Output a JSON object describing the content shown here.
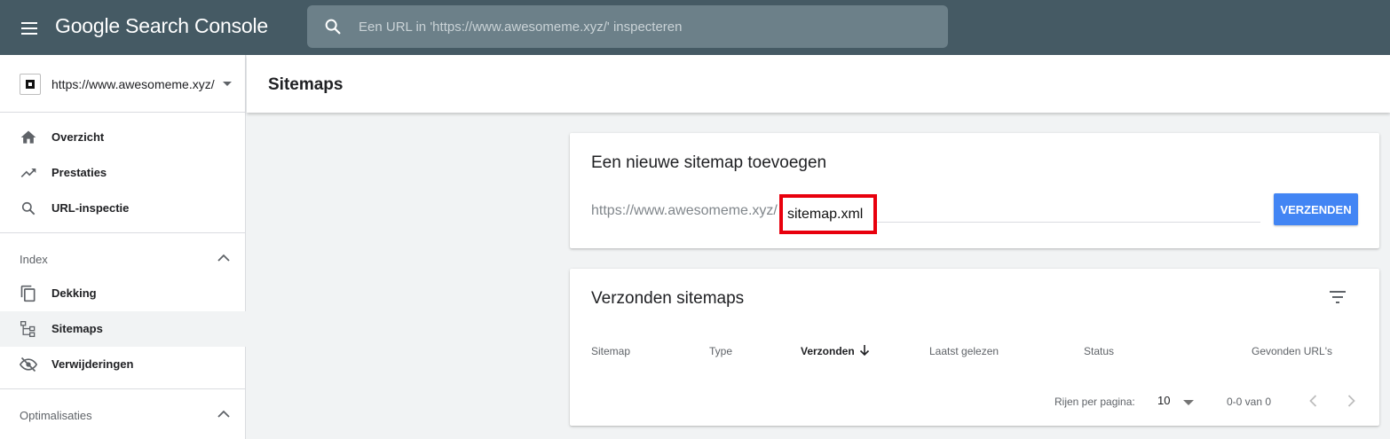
{
  "header": {
    "app_name": "Google Search Console",
    "search_placeholder": "Een URL in 'https://www.awesomeme.xyz/' inspecteren"
  },
  "sidebar": {
    "property": "https://www.awesomeme.xyz/",
    "items": [
      {
        "label": "Overzicht",
        "icon": "home-icon"
      },
      {
        "label": "Prestaties",
        "icon": "trending-up-icon"
      },
      {
        "label": "URL-inspectie",
        "icon": "search-icon"
      }
    ],
    "index_section": {
      "label": "Index",
      "items": [
        {
          "label": "Dekking",
          "icon": "file-copy-icon"
        },
        {
          "label": "Sitemaps",
          "icon": "sitemap-icon",
          "active": true
        },
        {
          "label": "Verwijderingen",
          "icon": "visibility-off-icon"
        }
      ]
    },
    "optim_section": {
      "label": "Optimalisaties"
    }
  },
  "page": {
    "title": "Sitemaps"
  },
  "add_card": {
    "title": "Een nieuwe sitemap toevoegen",
    "prefix": "https://www.awesomeme.xyz/",
    "input_value": "sitemap.xml",
    "submit_label": "VERZENDEN",
    "highlight_color": "#e8000d",
    "button_color": "#4285f4"
  },
  "submitted_card": {
    "title": "Verzonden sitemaps",
    "columns": [
      "Sitemap",
      "Type",
      "Verzonden",
      "Laatst gelezen",
      "Status",
      "Gevonden URL's"
    ],
    "sorted_column": "Verzonden",
    "rows_per_page_label": "Rijen per pagina:",
    "rows_per_page": "10",
    "range": "0-0 van 0"
  }
}
